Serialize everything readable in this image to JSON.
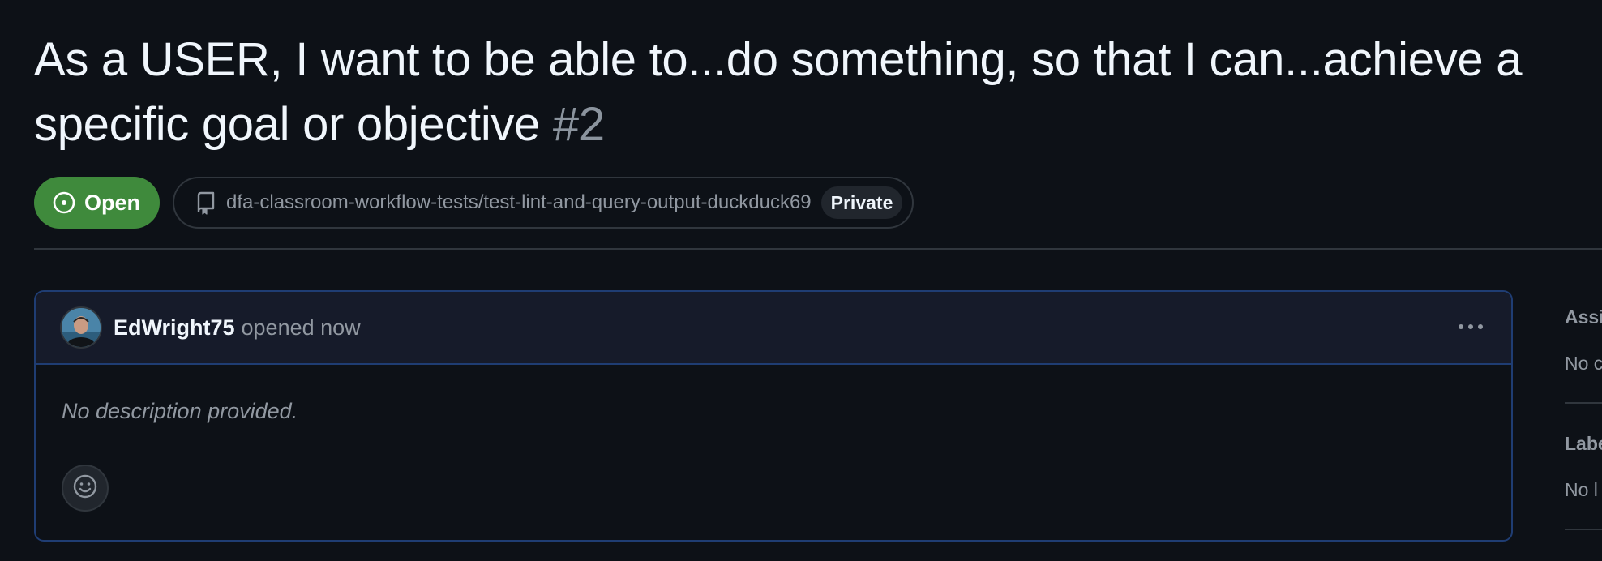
{
  "issue": {
    "title": "As a USER, I want to be able to...do something, so that I can...achieve a specific goal or objective",
    "number": "#2",
    "state_label": "Open",
    "repository": "dfa-classroom-workflow-tests/test-lint-and-query-output-duckduck69",
    "visibility": "Private"
  },
  "comment": {
    "author": "EdWright75",
    "action_text": "opened now",
    "body": "No description provided."
  },
  "sidebar": {
    "assignees_heading": "Assi",
    "assignees_value": "No c",
    "labels_heading": "Labe",
    "labels_value": "No l"
  },
  "colors": {
    "background": "#0d1117",
    "open_green": "#3f8a3c",
    "border_blue": "#1f3d73",
    "muted_text": "#9198a1"
  },
  "icons": {
    "state": "issue-opened-icon",
    "repo": "repo-icon",
    "menu": "kebab-horizontal-icon",
    "reaction": "smiley-icon"
  }
}
